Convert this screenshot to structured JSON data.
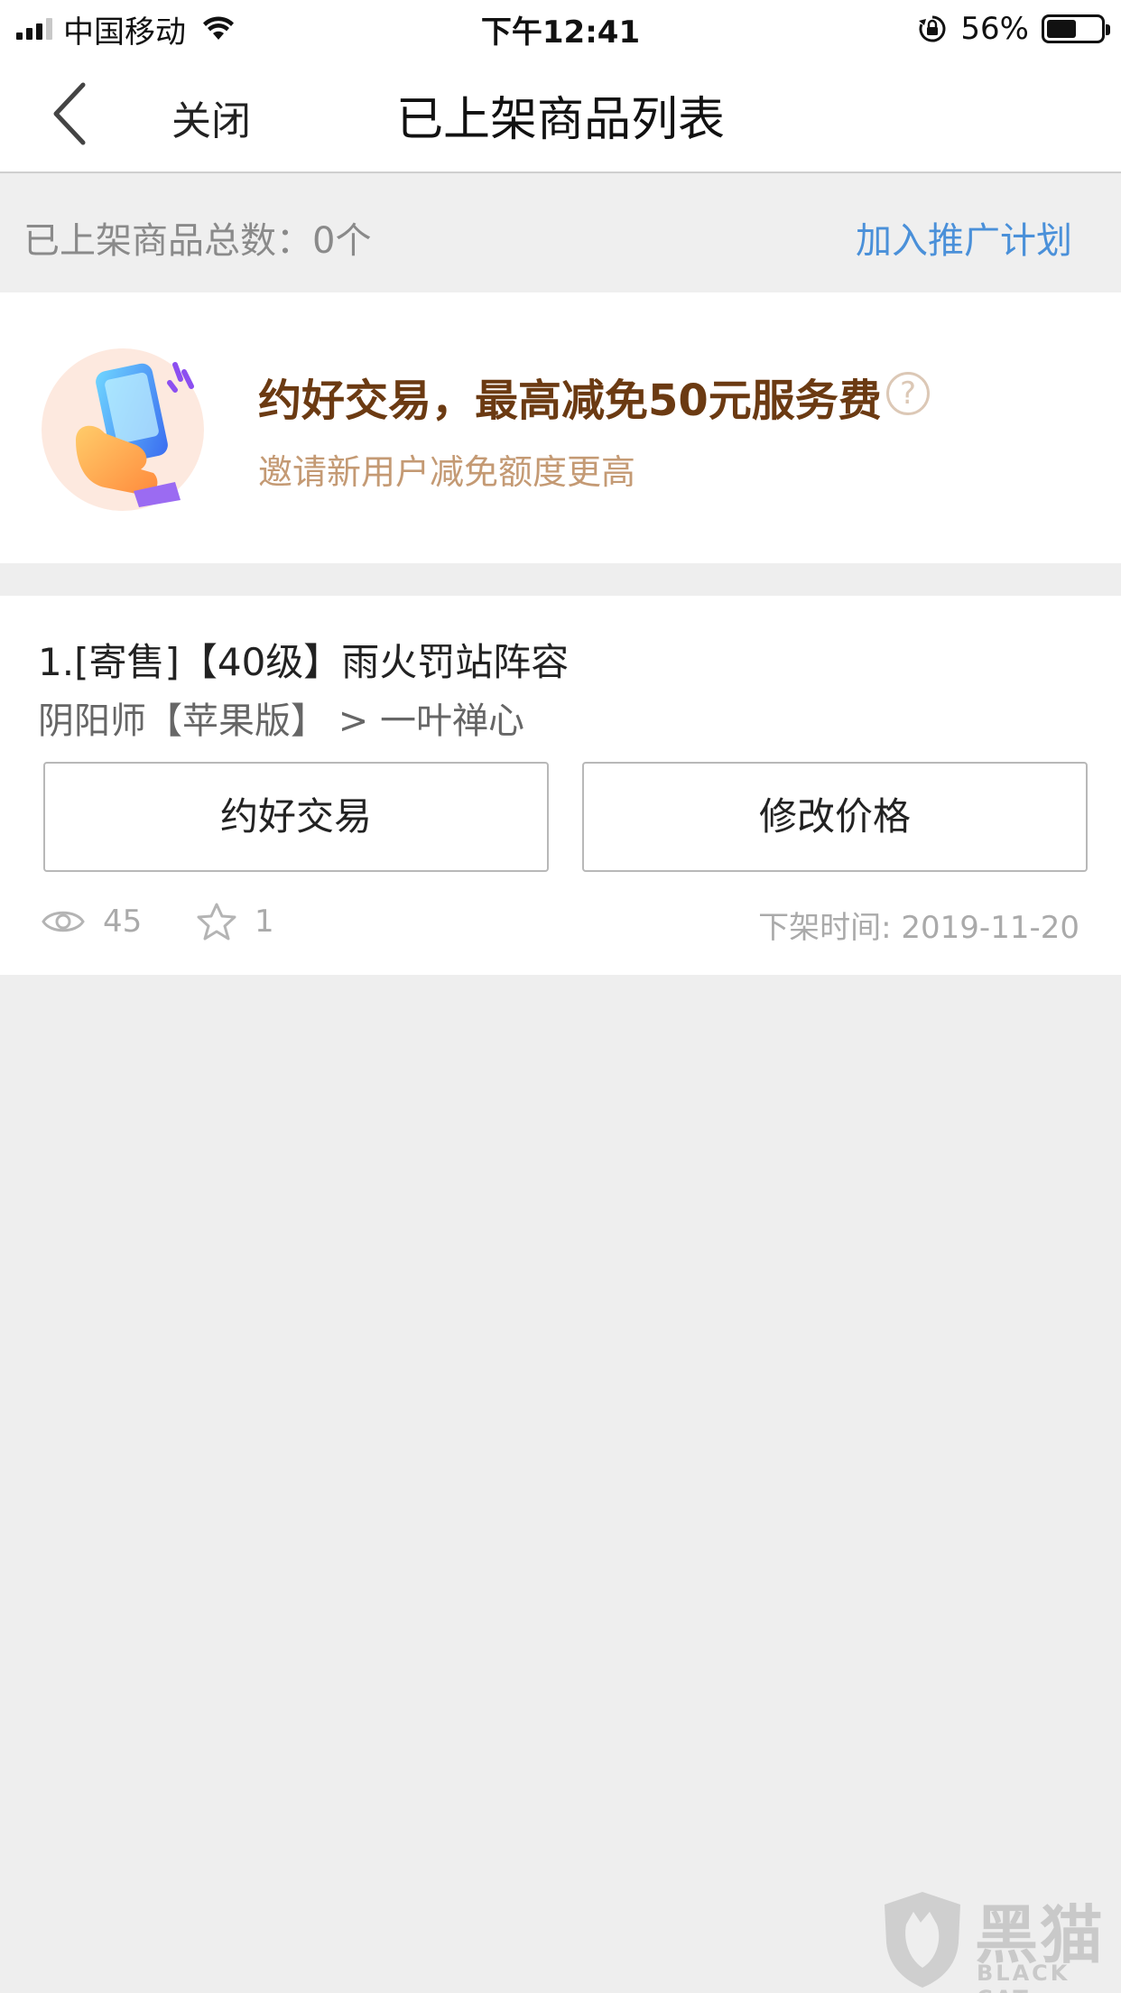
{
  "status_bar": {
    "carrier": "中国移动",
    "time": "下午12:41",
    "battery": "56%",
    "battery_level": 0.56
  },
  "nav": {
    "close_label": "关闭",
    "title": "已上架商品列表"
  },
  "summary": {
    "count_text": "已上架商品总数：0个",
    "promo_link": "加入推广计划"
  },
  "promo": {
    "title": "约好交易，最高减免50元服务费",
    "subtitle": "邀请新用户减免额度更高",
    "help_symbol": "?"
  },
  "item": {
    "title": "1.[寄售]【40级】雨火罚站阵容",
    "game": "阴阳师【苹果版】 > 一叶禅心",
    "deal_button": "约好交易",
    "price_button": "修改价格",
    "views": "45",
    "favorites": "1",
    "offline_time": "下架时间: 2019-11-20"
  },
  "watermark": {
    "cn": "黑猫",
    "en": "BLACK CAT"
  },
  "colors": {
    "link": "#4a90d9",
    "promo_title": "#6b3a12",
    "promo_sub": "#c49a74",
    "background": "#eeeeee"
  }
}
